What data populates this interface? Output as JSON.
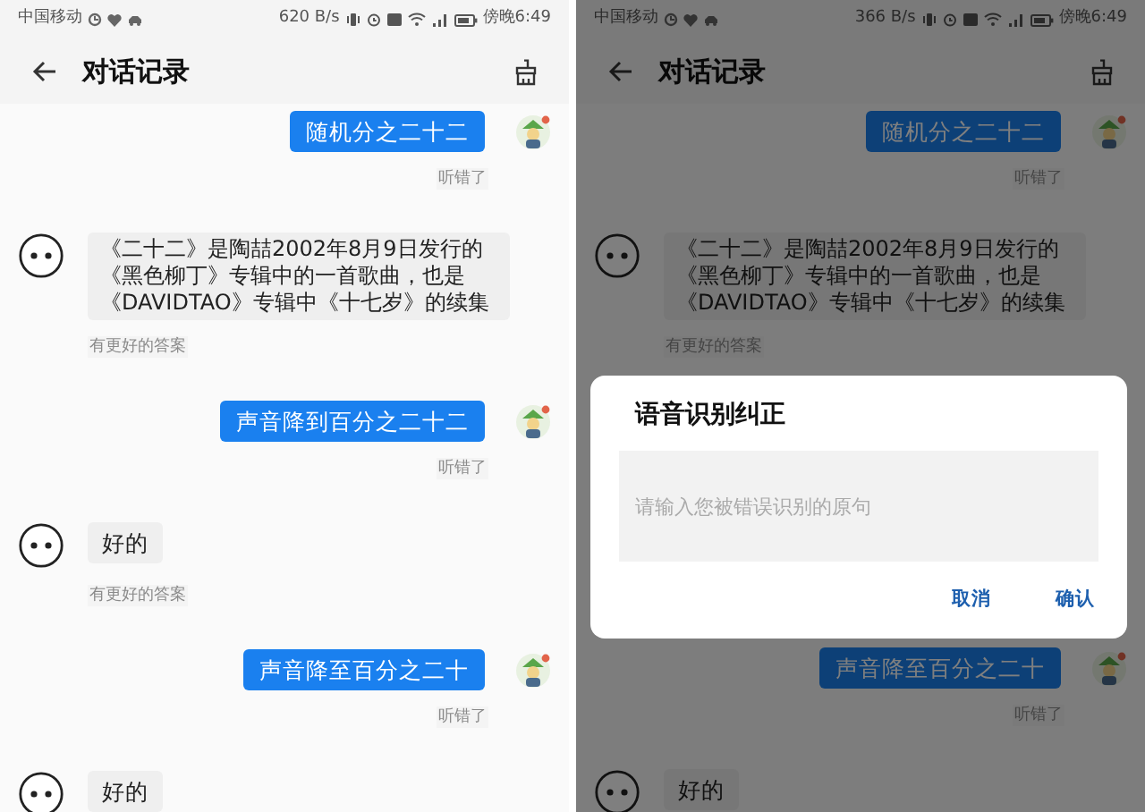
{
  "screens": [
    {
      "status_bar": {
        "carrier": "中国移动",
        "speed": "620 B/s",
        "time": "傍晚6:49"
      },
      "title": "对话记录",
      "messages": [
        {
          "kind": "user",
          "text": "随机分之二十二",
          "feedback": "听错了"
        },
        {
          "kind": "bot",
          "text": "《二十二》是陶喆2002年8月9日发行的《黑色柳丁》专辑中的一首歌曲，也是《DAVIDTAO》专辑中《十七岁》的续集",
          "feedback": "有更好的答案"
        },
        {
          "kind": "user",
          "text": "声音降到百分之二十二",
          "feedback": "听错了"
        },
        {
          "kind": "bot",
          "text": "好的",
          "feedback": "有更好的答案"
        },
        {
          "kind": "user",
          "text": "声音降至百分之二十",
          "feedback": "听错了"
        },
        {
          "kind": "bot",
          "text": "好的"
        }
      ]
    },
    {
      "dimmed": true,
      "status_bar": {
        "carrier": "中国移动",
        "speed": "366 B/s",
        "time": "傍晚6:49"
      },
      "title": "对话记录",
      "messages": [
        {
          "kind": "user",
          "text": "随机分之二十二",
          "feedback": "听错了"
        },
        {
          "kind": "bot",
          "text": "《二十二》是陶喆2002年8月9日发行的《黑色柳丁》专辑中的一首歌曲，也是《DAVIDTAO》专辑中《十七岁》的续集",
          "feedback": "有更好的答案"
        }
      ],
      "messages_below": [
        {
          "kind": "user",
          "text": "声音降至百分之二十",
          "feedback": "听错了"
        },
        {
          "kind": "bot",
          "text": "好的"
        }
      ],
      "dialog": {
        "title": "语音识别纠正",
        "placeholder": "请输入您被错误识别的原句",
        "buttons": [
          "取消",
          "确认"
        ]
      }
    }
  ]
}
